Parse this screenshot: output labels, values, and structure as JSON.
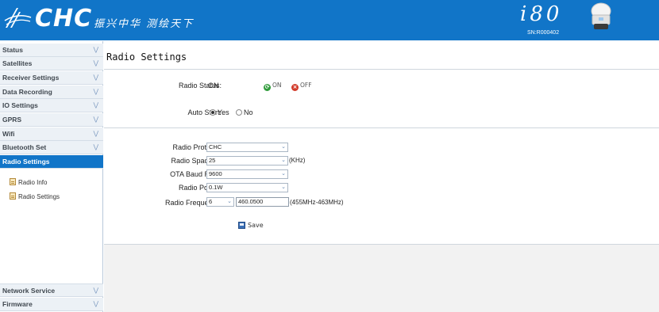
{
  "header": {
    "logo": "CHC",
    "slogan": "振兴中华 测绘天下",
    "model": "i80",
    "serial": "SN:R000402"
  },
  "sidebar": {
    "items": [
      {
        "label": "Status"
      },
      {
        "label": "Satellites"
      },
      {
        "label": "Receiver Settings"
      },
      {
        "label": "Data Recording"
      },
      {
        "label": "IO Settings"
      },
      {
        "label": "GPRS"
      },
      {
        "label": "Wifi"
      },
      {
        "label": "Bluetooth Set"
      },
      {
        "label": "Radio Settings"
      }
    ],
    "sub_items": [
      {
        "label": "Radio Info"
      },
      {
        "label": "Radio Settings"
      }
    ],
    "bottom_items": [
      {
        "label": "Network Service"
      },
      {
        "label": "Firmware"
      }
    ]
  },
  "main": {
    "title": "Radio Settings",
    "radio_status": {
      "label": "Radio Status:",
      "value": "ON",
      "on_label": "ON",
      "off_label": "OFF"
    },
    "auto_start": {
      "label": "Auto Start:",
      "yes": "Yes",
      "no": "No",
      "selected": "Yes"
    },
    "protocol": {
      "label": "Radio Protocol:",
      "value": "CHC"
    },
    "spacing": {
      "label": "Radio Spacing :",
      "value": "25",
      "unit": "(KHz)"
    },
    "baud": {
      "label": "OTA Baud Rate:",
      "value": "9600"
    },
    "power": {
      "label": "Radio Power:",
      "value": "0.1W"
    },
    "frequency": {
      "label": "Radio Frequency:",
      "channel": "6",
      "value": "460.0500",
      "range": "(455MHz-463MHz)"
    },
    "save_label": "Save"
  },
  "colors": {
    "accent": "#1175c8",
    "nav_bg": "#ecf1f6",
    "on_green": "#2f9b3a",
    "off_red": "#d23b2a"
  }
}
